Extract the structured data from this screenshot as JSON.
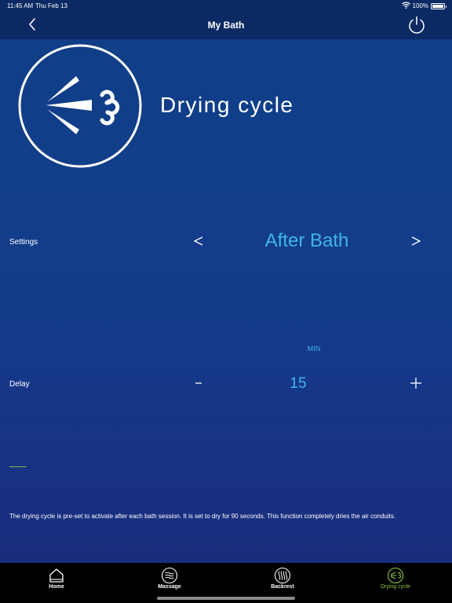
{
  "status": {
    "time": "11:45 AM",
    "date": "Thu Feb 13",
    "battery": "100%",
    "battery_level": 1.0
  },
  "header": {
    "title": "My Bath",
    "back_icon": "chevron-left-icon",
    "power_icon": "power-icon"
  },
  "hero": {
    "icon": "drying-cycle-icon",
    "title": "Drying cycle"
  },
  "settings": {
    "label": "Settings",
    "value": "After Bath",
    "prev_symbol": "<",
    "next_symbol": ">"
  },
  "delay": {
    "label": "Delay",
    "unit": "MIN",
    "value": "15",
    "minus_symbol": "−",
    "plus_symbol": "+"
  },
  "info": {
    "text": "The drying cycle is pre-set to activate after each bath session. It is set to dry for 90 seconds. This function completely dries the air conduits."
  },
  "tabs": [
    {
      "label": "Home",
      "icon": "home-icon",
      "active": false
    },
    {
      "label": "Massage",
      "icon": "massage-icon",
      "active": false
    },
    {
      "label": "Backrest",
      "icon": "backrest-icon",
      "active": false
    },
    {
      "label": "Drying cycle",
      "icon": "drying-cycle-icon",
      "active": true
    }
  ],
  "colors": {
    "accent": "#3fb6e8",
    "active_tab": "#8cc63f",
    "background_top": "#0f3d86",
    "background_bottom": "#1b2a7a",
    "bar": "#0b2a63"
  }
}
